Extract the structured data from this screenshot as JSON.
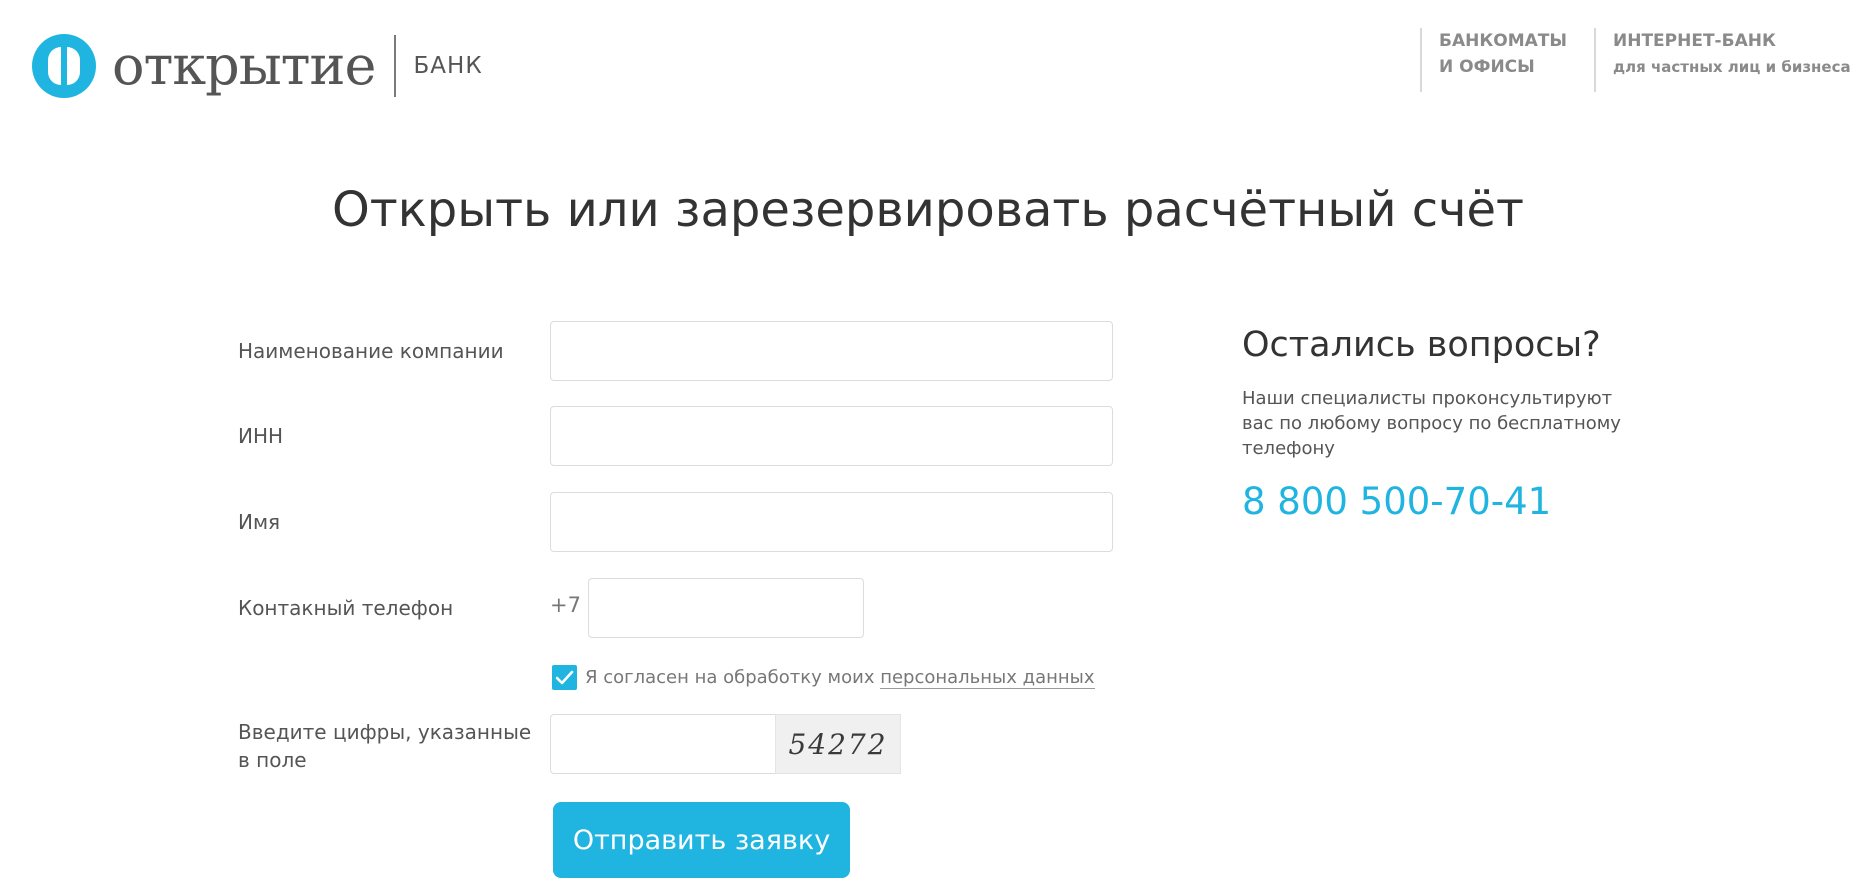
{
  "header": {
    "logo_text": "открытие",
    "logo_suffix": "БАНК",
    "nav": [
      {
        "line1": "БАНКОМАТЫ",
        "line2": "И ОФИСЫ"
      },
      {
        "line1": "ИНТЕРНЕТ-БАНК",
        "line2": "для частных лиц и бизнеса"
      }
    ]
  },
  "page": {
    "title": "Открыть или зарезервировать расчётный счёт"
  },
  "form": {
    "company": {
      "label": "Наименование компании",
      "value": ""
    },
    "inn": {
      "label": "ИНН",
      "value": ""
    },
    "name": {
      "label": "Имя",
      "value": ""
    },
    "phone": {
      "label": "Контакный телефон",
      "prefix": "+7",
      "value": ""
    },
    "consent": {
      "text": "Я согласен на обработку моих",
      "link": "персональных данных",
      "checked": true
    },
    "captcha": {
      "label_line1": "Введите цифры, указанные",
      "label_line2": "в поле",
      "value": "",
      "code": "54272"
    },
    "submit_label": "Отправить заявку"
  },
  "sidebar": {
    "title": "Остались вопросы?",
    "text": "Наши специалисты проконсультируют вас по любому вопросу по бесплатному телефону",
    "phone": "8 800 500-70-41"
  },
  "colors": {
    "accent": "#1fb5e0",
    "text": "#333333",
    "muted": "#777777"
  }
}
